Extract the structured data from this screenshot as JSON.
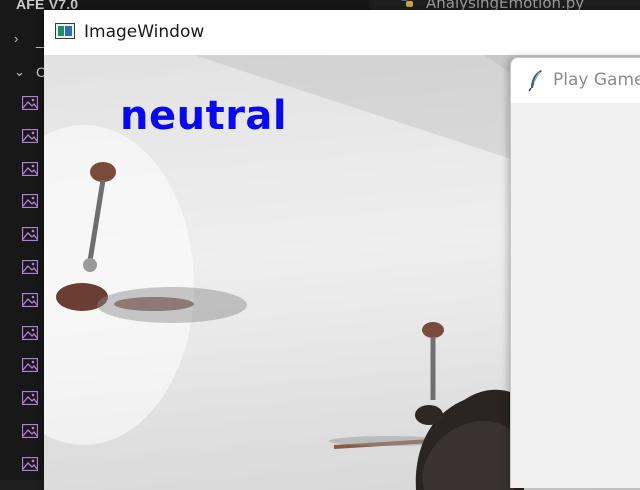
{
  "explorer": {
    "root_label": "AFE V7.0",
    "items": [
      {
        "type": "folder",
        "expanded": false,
        "label": "_"
      },
      {
        "type": "folder",
        "expanded": true,
        "label": "C"
      },
      {
        "type": "file",
        "icon": "image-file-icon"
      },
      {
        "type": "file",
        "icon": "image-file-icon"
      },
      {
        "type": "file",
        "icon": "image-file-icon"
      },
      {
        "type": "file",
        "icon": "image-file-icon"
      },
      {
        "type": "file",
        "icon": "image-file-icon"
      },
      {
        "type": "file",
        "icon": "image-file-icon"
      },
      {
        "type": "file",
        "icon": "image-file-icon"
      },
      {
        "type": "file",
        "icon": "image-file-icon"
      },
      {
        "type": "file",
        "icon": "image-file-icon"
      },
      {
        "type": "file",
        "icon": "image-file-icon"
      },
      {
        "type": "file",
        "icon": "image-file-icon"
      },
      {
        "type": "file",
        "icon": "image-file-icon"
      }
    ]
  },
  "editor": {
    "active_tab": "AnalysingEmotion.py",
    "tab_icon": "python-icon"
  },
  "image_window": {
    "title": "ImageWindow",
    "icon": "opencv-window-icon",
    "overlay_text": "neutral",
    "overlay_color": "#0a0aee"
  },
  "play_window": {
    "title": "Play Game",
    "icon": "feather-icon"
  }
}
